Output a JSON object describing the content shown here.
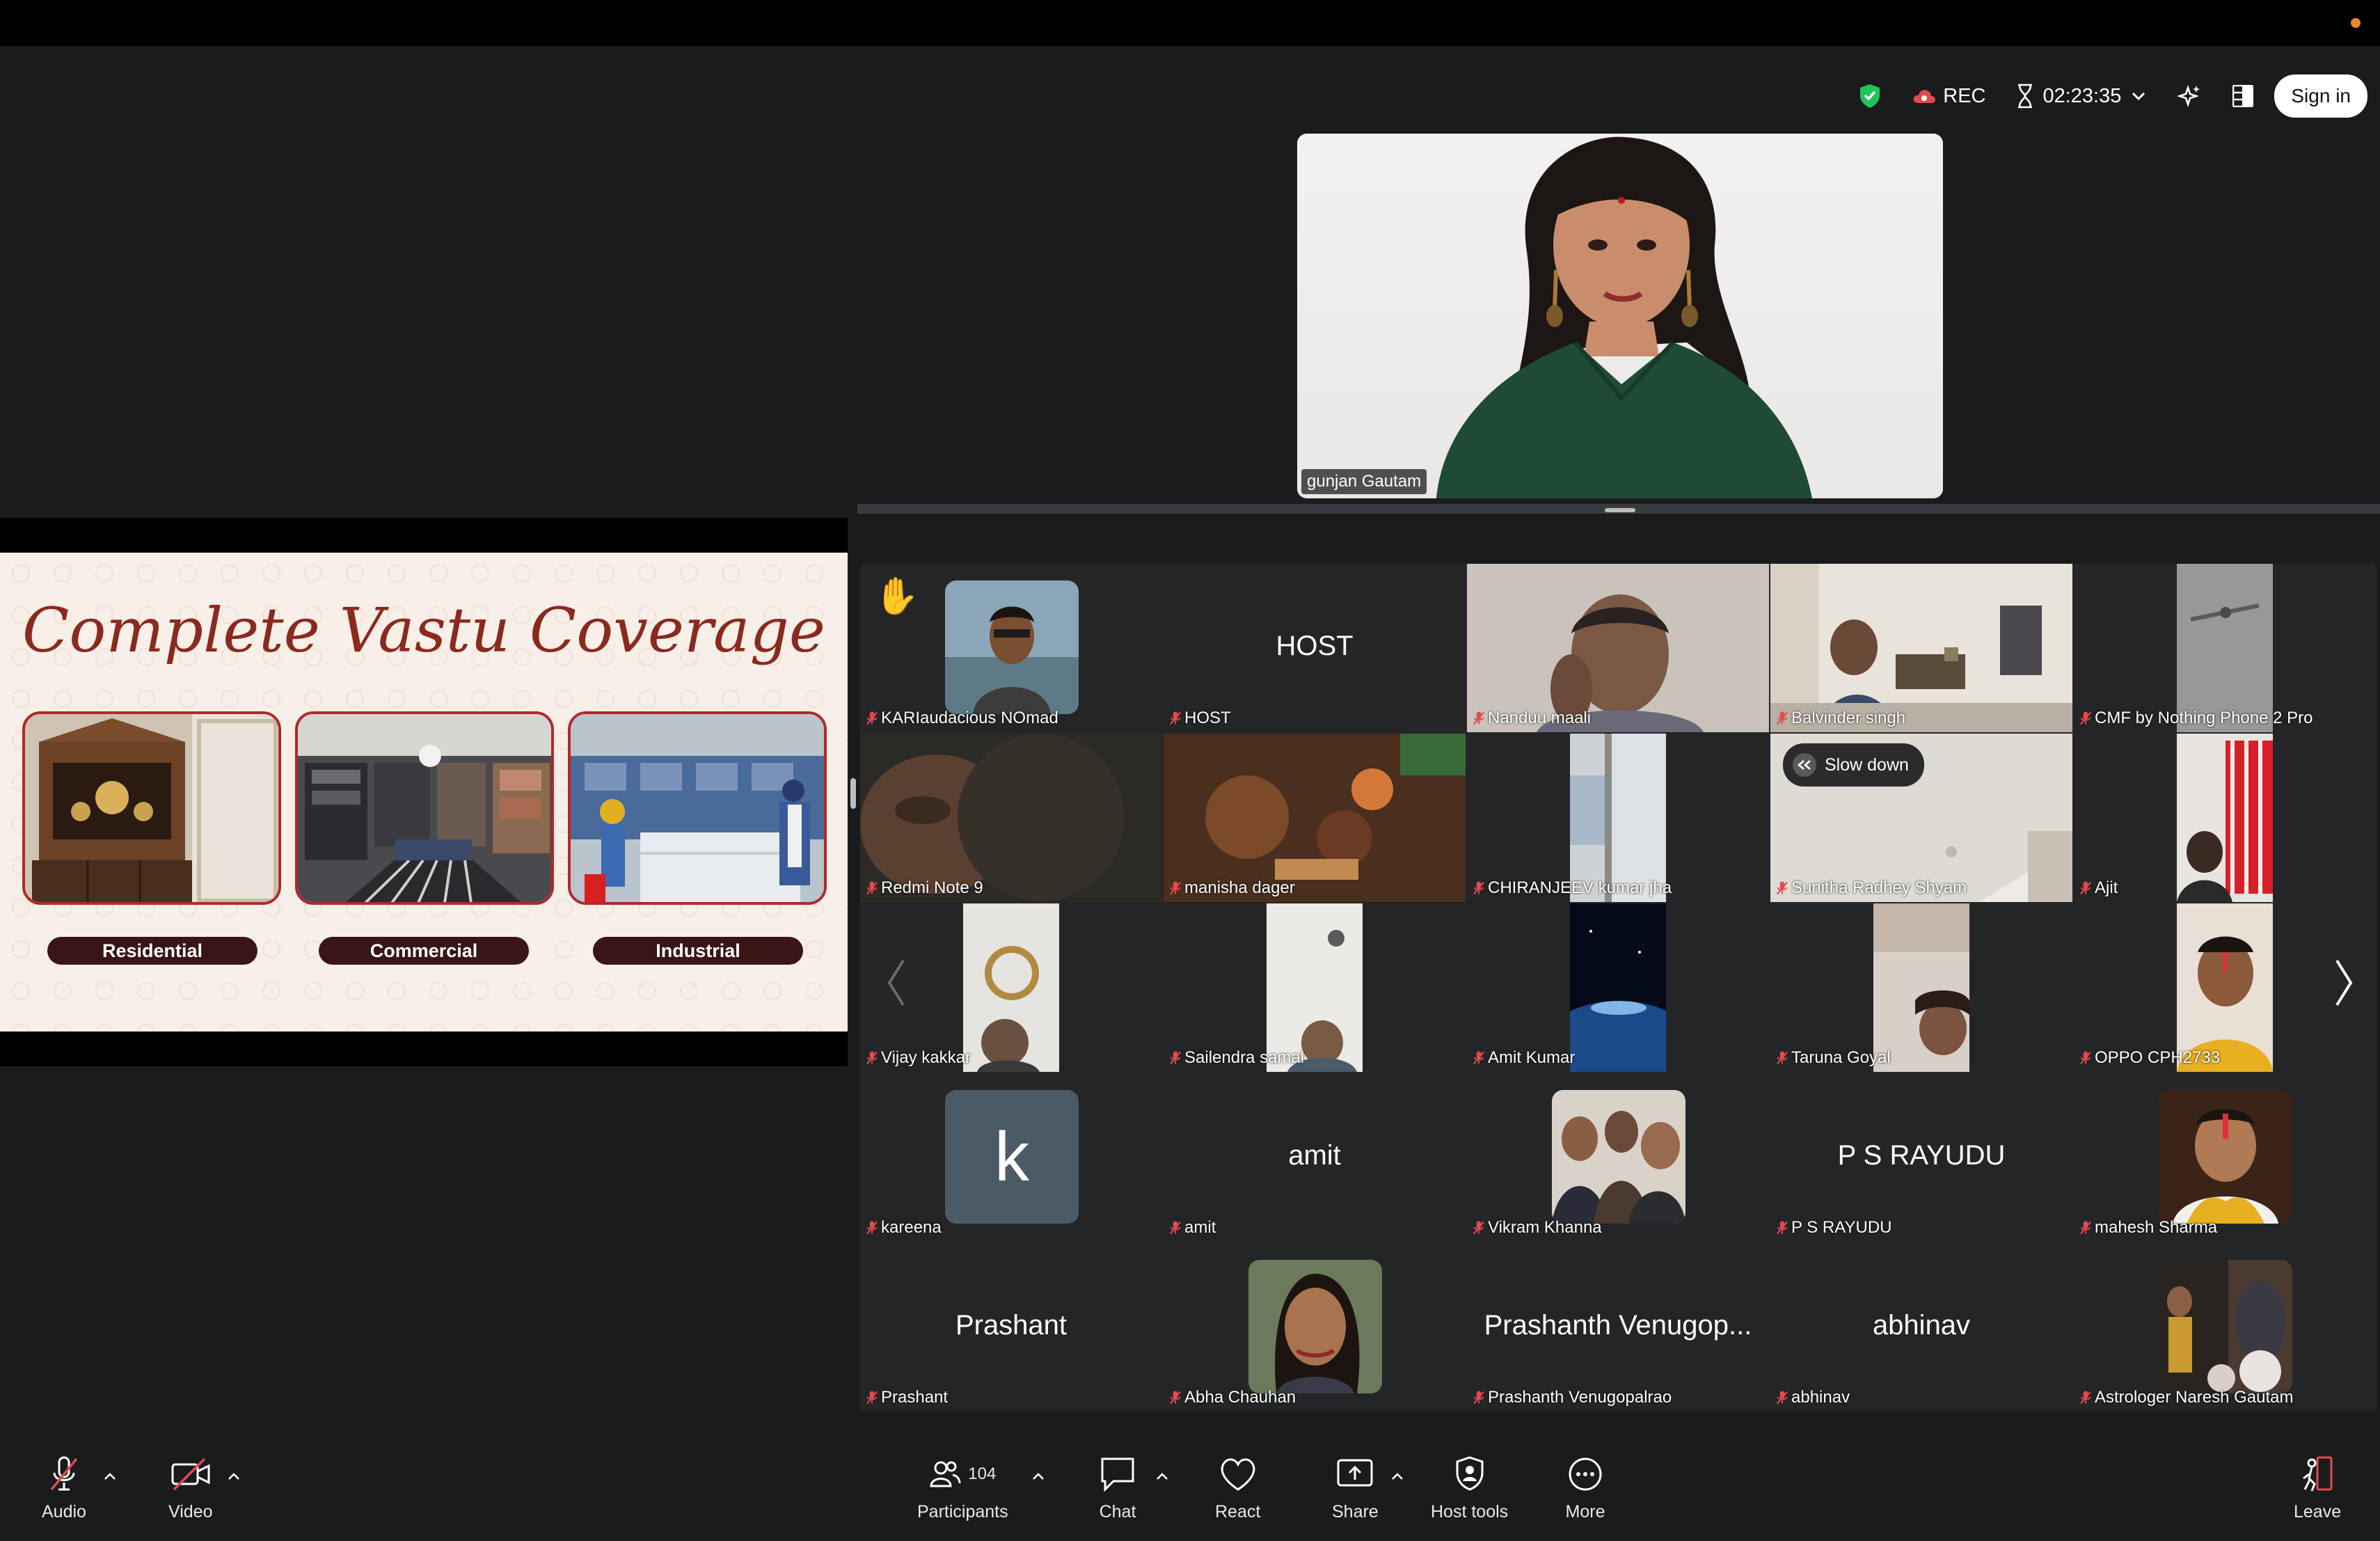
{
  "top_controls": {
    "rec_label": "REC",
    "timer": "02:23:35",
    "sign_in_label": "Sign in"
  },
  "speaker": {
    "name": "gunjan Gautam"
  },
  "slide": {
    "title": "Complete Vastu Coverage",
    "labels": [
      "Residential",
      "Commercial",
      "Industrial"
    ]
  },
  "gallery": {
    "tiles": [
      {
        "name": "KARIaudacious NOmad"
      },
      {
        "name": "HOST",
        "center": "HOST"
      },
      {
        "name": "Nanduu maali"
      },
      {
        "name": "Balvinder singh"
      },
      {
        "name": "CMF by Nothing Phone 2 Pro"
      },
      {
        "name": "Redmi Note 9"
      },
      {
        "name": "manisha dager"
      },
      {
        "name": "CHIRANJEEV kumar jha"
      },
      {
        "name": "Sunitha Radhey Shyam"
      },
      {
        "name": "Ajit"
      },
      {
        "name": "Vijay kakkar"
      },
      {
        "name": "Sailendra samal"
      },
      {
        "name": "Amit Kumar"
      },
      {
        "name": "Taruna Goyal"
      },
      {
        "name": "OPPO CPH2733"
      },
      {
        "name": "kareena",
        "avatar_letter": "k"
      },
      {
        "name": "amit",
        "center": "amit"
      },
      {
        "name": "Vikram Khanna"
      },
      {
        "name": "P S RAYUDU",
        "center": "P S RAYUDU"
      },
      {
        "name": "mahesh Sharma"
      },
      {
        "name": "Prashant",
        "center": "Prashant"
      },
      {
        "name": "Abha Chauhan"
      },
      {
        "name": "Prashanth Venugopalrao",
        "center": "Prashanth Venugop..."
      },
      {
        "name": "abhinav",
        "center": "abhinav"
      },
      {
        "name": "Astrologer Naresh Gautam"
      }
    ],
    "slow_down_label": "Slow down"
  },
  "toolbar": {
    "audio": "Audio",
    "video": "Video",
    "participants": "Participants",
    "participants_count": "104",
    "chat": "Chat",
    "react": "React",
    "share": "Share",
    "host_tools": "Host tools",
    "more": "More",
    "leave": "Leave"
  },
  "colors": {
    "background": "#1a1b1d",
    "gallery_bg": "#242527",
    "slide_title": "#8a2a1f",
    "muted_red": "#e5484d",
    "security_green": "#21c45a",
    "slide_label_bg": "#3a1516"
  }
}
